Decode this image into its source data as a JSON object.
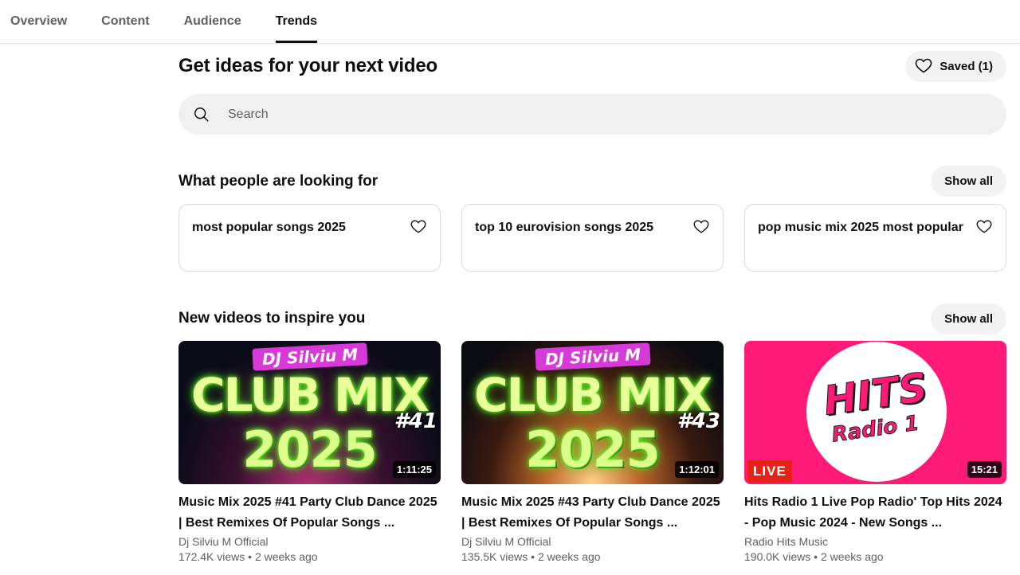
{
  "tabs": [
    {
      "label": "Overview",
      "active": false
    },
    {
      "label": "Content",
      "active": false
    },
    {
      "label": "Audience",
      "active": false
    },
    {
      "label": "Trends",
      "active": true
    }
  ],
  "header": {
    "title": "Get ideas for your next video",
    "saved_label": "Saved (1)",
    "saved_icon": "heart-icon"
  },
  "search": {
    "placeholder": "Search",
    "value": "",
    "icon": "search-icon"
  },
  "looking_for": {
    "title": "What people are looking for",
    "show_all": "Show all",
    "items": [
      {
        "text": "most popular songs 2025",
        "icon": "heart-outline-icon"
      },
      {
        "text": "top 10 eurovision songs 2025",
        "icon": "heart-outline-icon"
      },
      {
        "text": "pop music mix 2025 most popular",
        "icon": "heart-outline-icon"
      }
    ]
  },
  "inspire": {
    "title": "New videos to inspire you",
    "show_all": "Show all",
    "videos": [
      {
        "title": "Music Mix 2025 #41 Party Club Dance 2025 | Best Remixes Of Popular Songs ...",
        "channel": "Dj Silviu M Official",
        "meta": "172.4K views • 2 weeks ago",
        "duration": "1:11:25",
        "thumb": {
          "tag": "DJ Silviu M",
          "word": "CLUB MIX",
          "year": "2025",
          "num": "#41"
        }
      },
      {
        "title": "Music Mix 2025 #43 Party Club Dance 2025 | Best Remixes Of Popular Songs ...",
        "channel": "Dj Silviu M Official",
        "meta": "135.5K views • 2 weeks ago",
        "duration": "1:12:01",
        "thumb": {
          "tag": "DJ Silviu M",
          "word": "CLUB MIX",
          "year": "2025",
          "num": "#43"
        }
      },
      {
        "title": "Hits Radio 1 Live Pop Radio' Top Hits 2024 - Pop Music 2024 - New Songs ...",
        "channel": "Radio Hits Music",
        "meta": "190.0K views • 2 weeks ago",
        "duration": "15:21",
        "live": "LIVE",
        "thumb": {
          "word": "HITS",
          "sub": "Radio 1"
        }
      }
    ]
  },
  "colors": {
    "accent": "#0f0f0f",
    "secondary_text": "#606060",
    "chip_bg": "#f2f2f2",
    "live_red": "#e62117",
    "hits_pink": "#ff1a78"
  }
}
